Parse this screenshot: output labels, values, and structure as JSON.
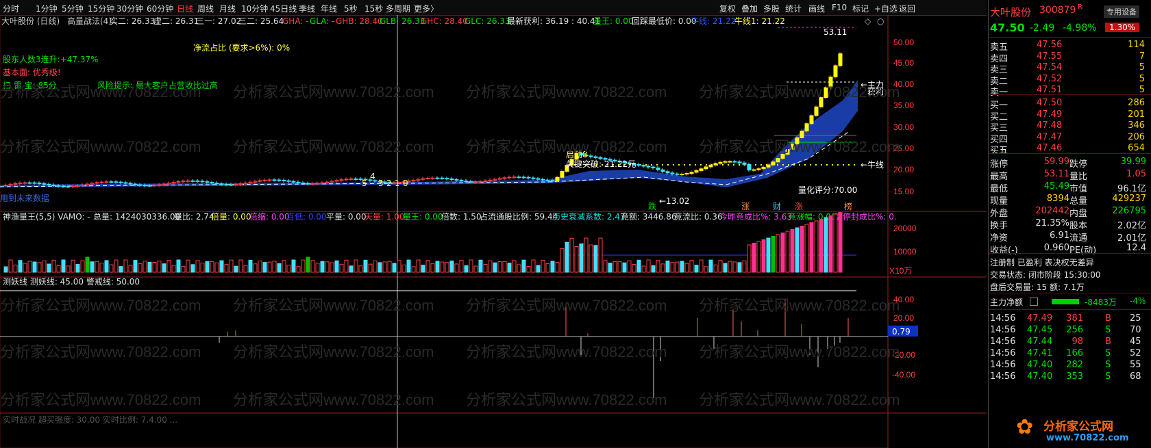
{
  "toolbar": {
    "left": [
      "分时",
      "1分钟",
      "5分钟",
      "15分钟",
      "30分钟",
      "60分钟",
      "日线",
      "周线",
      "月线",
      "10分钟",
      "45日线",
      "季线",
      "年线",
      "5秒",
      "15秒",
      "多周期",
      "更多〉"
    ],
    "selected": "日线",
    "right": [
      "复权",
      "叠加",
      "多股",
      "统计",
      "画线",
      "F10",
      "标记",
      "+自选",
      "返回"
    ]
  },
  "main": {
    "info1": {
      "name": "大叶股份 (日线)",
      "ind": "高量战法(4)",
      "s1": "实二: 26.33",
      "s2": "虚二: 26.31",
      "s3": "三一: 27.02",
      "s4": "三二: 25.64",
      "gha": "GHA: -",
      "gla": "GLA: -",
      "ghb": "GHB: 28.40",
      "glb": "GLB: 26.33",
      "ghc": "GHC: 28.40",
      "glc": "GLC: 26.33",
      "profit": "最新获利: 36.19 : 40.41",
      "lw": "量王: 0.00",
      "hc": "回踩最低价: 0.00",
      "nx": "牛线: 21.22",
      "nx1": "牛线1: 21.22"
    },
    "net_flow": "净流占比 (要求>6%): 0%",
    "holders": "股东人数3连升:+47.37%",
    "fundamentals": "基本面: 优秀级!",
    "saolei": "扫 雷 宝:   85分",
    "risk": "风险提示:   最大客户占营收比过高",
    "no_data": "用到未来数据",
    "ann": {
      "high": "53.11",
      "low": "←13.02",
      "qidong": "启动8",
      "guanjian": "关键突破: 21.22元",
      "pingfen": "量化评分:70.00",
      "niuxian": "←牛线",
      "zhuli": "←主力",
      "huoli": "获利",
      "d1": "5",
      "d2": "4",
      "d3": "3",
      "d4": "2",
      "d5": "1",
      "d6": "0"
    },
    "tags": [
      "跌",
      "涨",
      "财",
      "涨",
      "榜"
    ],
    "yticks": [
      "50.00",
      "45.00",
      "40.00",
      "35.00",
      "30.00",
      "25.00",
      "20.00",
      "15.00"
    ]
  },
  "vol": {
    "title": "神渔量王(5,5)  VAMO: -",
    "items": [
      "总量: 1424030336.00",
      "量比: 2.74",
      "倍量: 0.00",
      "倍缩: 0.00",
      "百低: 0.00",
      "平量: 0.00",
      "天量: 1.00",
      "量王: 0.00",
      "倍数: 1.50",
      "占流通股比例: 59.44",
      "历史衰减系数: 2.47",
      "竞额: 3446.86",
      "竞流比: 0.36",
      "今昨竞成比%: 3.63",
      "竞涨幅: 0.00",
      "涨停封成比%: 0."
    ],
    "yticks": [
      "20000",
      "10000"
    ],
    "unit": "X10万"
  },
  "osc": {
    "title": "测妖线  测妖线: 45.00  警戒线: 50.00",
    "yticks": [
      "40.00",
      "20.00",
      "-20.00",
      "-40.00"
    ],
    "current": "0.79"
  },
  "bottom_strip": "实时战况  超买强度: 30.00  实时比例: 7.4.00 ...",
  "quote": {
    "name": "大叶股份",
    "code": "300879",
    "flag": "R",
    "badge": "专用设备",
    "price": "47.50",
    "change": "-2.49",
    "pct": "-4.98%",
    "badge2": "1.30%",
    "asks": [
      [
        "卖五",
        "47.56",
        "114"
      ],
      [
        "卖四",
        "47.55",
        "7"
      ],
      [
        "卖三",
        "47.54",
        "5"
      ],
      [
        "卖二",
        "47.52",
        "5"
      ],
      [
        "卖一",
        "47.51",
        "5"
      ]
    ],
    "bids": [
      [
        "买一",
        "47.50",
        "286"
      ],
      [
        "买二",
        "47.49",
        "201"
      ],
      [
        "买三",
        "47.48",
        "346"
      ],
      [
        "买四",
        "47.47",
        "206"
      ],
      [
        "买五",
        "47.46",
        "654"
      ]
    ],
    "stats": [
      [
        "涨停",
        "59.99",
        "跌停",
        "39.99"
      ],
      [
        "最高",
        "53.11",
        "量比",
        "1.05"
      ],
      [
        "最低",
        "45.49",
        "市值",
        "96.1亿"
      ],
      [
        "现量",
        "8394",
        "总量",
        "429237"
      ],
      [
        "外盘",
        "202442",
        "内盘",
        "226795"
      ],
      [
        "换手",
        "21.35%",
        "股本",
        "2.02亿"
      ],
      [
        "净资",
        "6.91",
        "流通",
        "2.01亿"
      ],
      [
        "收益(-)",
        "0.960",
        "PE(动)",
        "12.4"
      ]
    ],
    "info": [
      "注册制  已盈利  表决权无差异",
      "交易状态: 闭市阶段 15:30:00",
      "盘后交易量: 15  额: 7.1万"
    ],
    "netflow_label": "主力净额",
    "netflow_val": "-8483万",
    "netflow_pct": "-4%",
    "ticks": [
      [
        "14:56",
        "47.49",
        "381",
        "B",
        "25"
      ],
      [
        "14:56",
        "47.45",
        "256",
        "S",
        "70"
      ],
      [
        "14:56",
        "47.44",
        "98",
        "B",
        "45"
      ],
      [
        "14:56",
        "47.41",
        "166",
        "S",
        "52"
      ],
      [
        "14:56",
        "47.40",
        "282",
        "S",
        "55"
      ],
      [
        "14:56",
        "47.40",
        "353",
        "S",
        "68"
      ]
    ],
    "logo": "分析家公式网",
    "logo_url": "www.70822.com"
  },
  "watermark": "分析家公式网www.70822.com"
}
